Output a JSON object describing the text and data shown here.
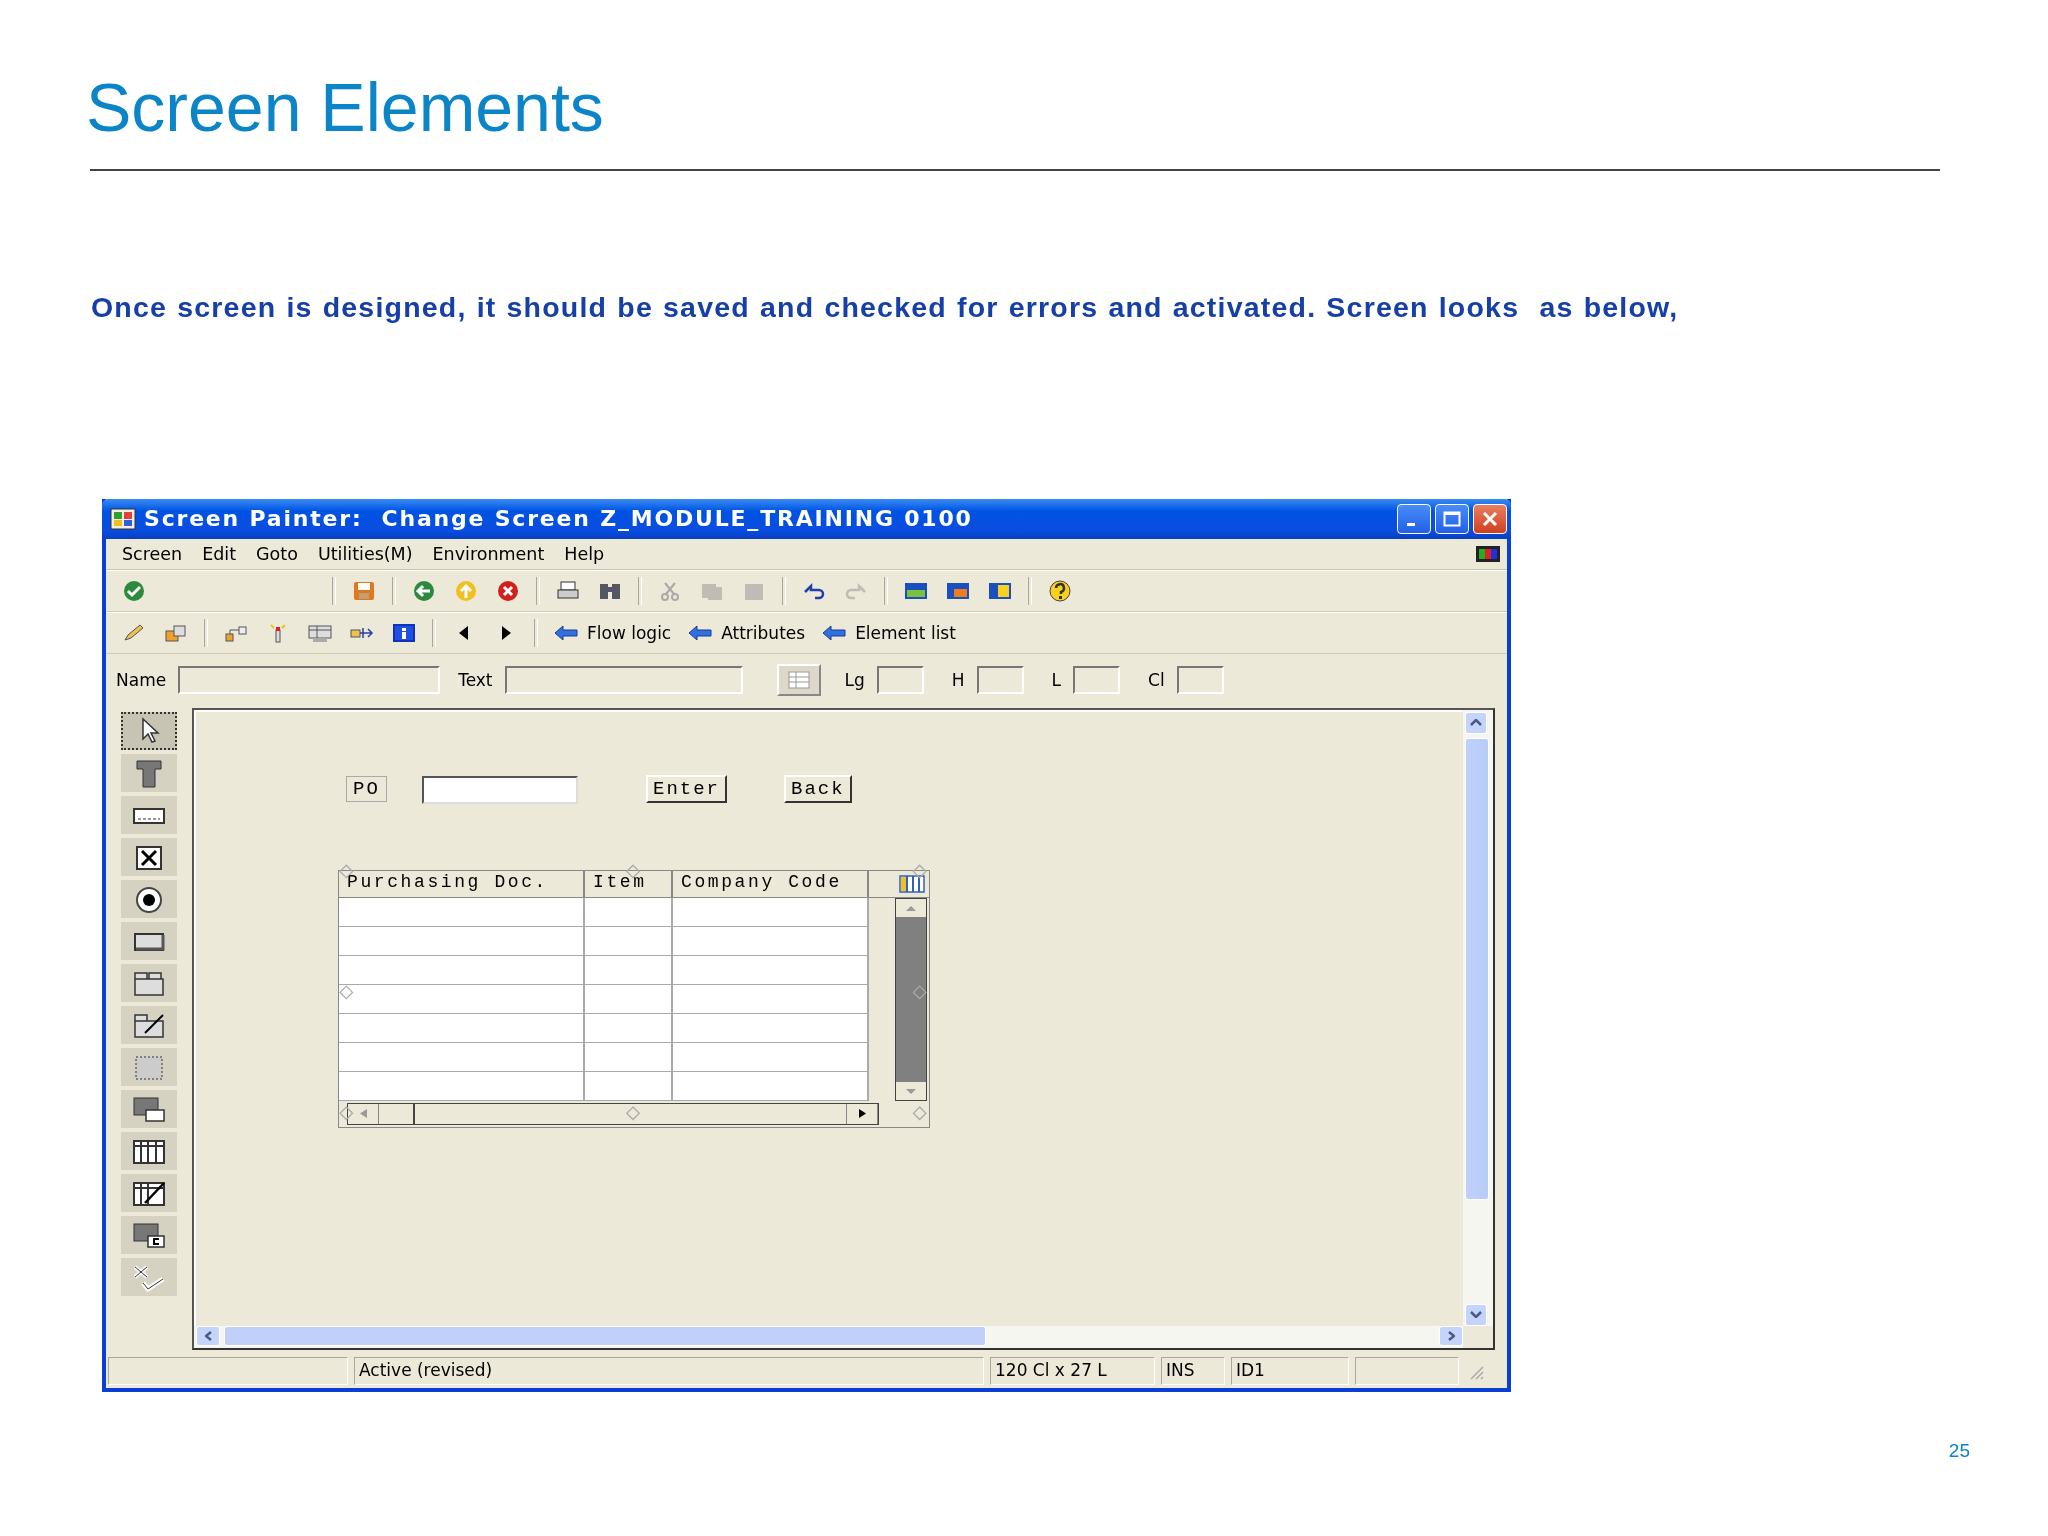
{
  "slide": {
    "title": "Screen Elements",
    "text": "Once screen is designed, it should be saved and checked for errors and activated. Screen looks  as below,",
    "page_number": "25"
  },
  "window": {
    "title": "Screen Painter:  Change Screen Z_MODULE_TRAINING 0100"
  },
  "menu": [
    {
      "label": "Screen"
    },
    {
      "label": "Edit"
    },
    {
      "label": "Goto"
    },
    {
      "label": "Utilities(M)"
    },
    {
      "label": "Environment"
    },
    {
      "label": "Help"
    }
  ],
  "toolbar": [
    [
      {
        "kind": "check",
        "disabled": false
      }
    ],
    [
      {
        "kind": "save",
        "disabled": false
      }
    ],
    [
      {
        "kind": "back",
        "disabled": false
      },
      {
        "kind": "exit",
        "disabled": false
      },
      {
        "kind": "cancel",
        "disabled": false
      }
    ],
    [
      {
        "kind": "print",
        "disabled": false
      },
      {
        "kind": "find",
        "disabled": false
      }
    ],
    [
      {
        "kind": "cut",
        "disabled": true
      },
      {
        "kind": "copy",
        "disabled": true
      },
      {
        "kind": "paste",
        "disabled": true
      }
    ],
    [
      {
        "kind": "undo",
        "disabled": false
      },
      {
        "kind": "redo",
        "disabled": true
      }
    ],
    [
      {
        "kind": "screen-green",
        "disabled": false
      },
      {
        "kind": "screen-orange",
        "disabled": false
      },
      {
        "kind": "screen-yellow",
        "disabled": false
      }
    ],
    [
      {
        "kind": "help",
        "disabled": false
      }
    ]
  ],
  "app_toolbar": [
    [
      {
        "kind": "pencil"
      },
      {
        "kind": "copy-element"
      }
    ],
    [
      {
        "kind": "hierarchy"
      },
      {
        "kind": "light"
      },
      {
        "kind": "layout"
      },
      {
        "kind": "move"
      },
      {
        "kind": "info"
      }
    ],
    [
      {
        "kind": "previous"
      },
      {
        "kind": "next"
      }
    ],
    [
      {
        "kind": "arrow",
        "label": "Flow logic"
      },
      {
        "kind": "arrow",
        "label": "Attributes"
      },
      {
        "kind": "arrow",
        "label": "Element list"
      }
    ]
  ],
  "attributes_row": [
    {
      "kind": "field",
      "label": "Name"
    },
    {
      "kind": "field",
      "label": "Text"
    },
    {
      "kind": "icon-button"
    },
    {
      "kind": "small-field",
      "label": "Lg"
    },
    {
      "kind": "small-field",
      "label": "H"
    },
    {
      "kind": "small-field",
      "label": "L"
    },
    {
      "kind": "small-field",
      "label": "Cl"
    }
  ],
  "palette": [
    {
      "kind": "pointer",
      "selected": true
    },
    {
      "kind": "text",
      "selected": false
    },
    {
      "kind": "entry",
      "selected": false
    },
    {
      "kind": "checkbox",
      "selected": false
    },
    {
      "kind": "radio",
      "selected": false
    },
    {
      "kind": "pushbutton",
      "selected": false
    },
    {
      "kind": "tabstrip",
      "selected": false
    },
    {
      "kind": "tabstrip-wizard",
      "selected": false
    },
    {
      "kind": "box",
      "selected": false
    },
    {
      "kind": "subscreen",
      "selected": false
    },
    {
      "kind": "table",
      "selected": false
    },
    {
      "kind": "table-wizard",
      "selected": false
    },
    {
      "kind": "custom",
      "selected": false
    },
    {
      "kind": "status",
      "selected": false
    }
  ],
  "canvas": {
    "label": "PO",
    "buttons": [
      "Enter",
      "Back"
    ],
    "table_control": {
      "columns": [
        "Purchasing Doc.",
        "Item",
        "Company Code"
      ]
    }
  },
  "status_bar": [
    "Active (revised)",
    "120 Cl x 27 L",
    "INS",
    "ID1"
  ]
}
